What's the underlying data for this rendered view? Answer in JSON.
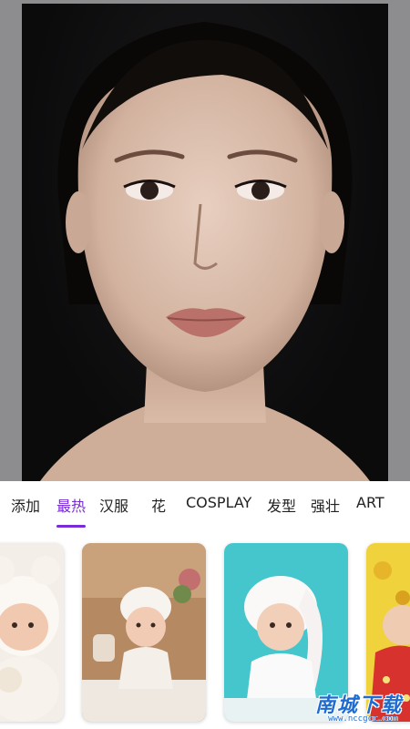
{
  "preview": {
    "subject": "portrait-photo"
  },
  "tabs": [
    {
      "label": "添加",
      "active": false
    },
    {
      "label": "最热",
      "active": true
    },
    {
      "label": "汉服",
      "active": false
    },
    {
      "label": "花",
      "active": false
    },
    {
      "label": "COSPLAY",
      "active": false
    },
    {
      "label": "发型",
      "active": false
    },
    {
      "label": "强壮",
      "active": false
    },
    {
      "label": "ART",
      "active": false
    }
  ],
  "templates": [
    {
      "id": "baby-bunny-hat"
    },
    {
      "id": "baby-lace-bonnet"
    },
    {
      "id": "baby-white-hood"
    },
    {
      "id": "child-red-dress"
    }
  ],
  "watermark": {
    "title": "南城下载",
    "url": "www.nccgcc.com"
  },
  "colors": {
    "accent": "#7a2bd8",
    "preview_bg": "#8d8d8f"
  }
}
